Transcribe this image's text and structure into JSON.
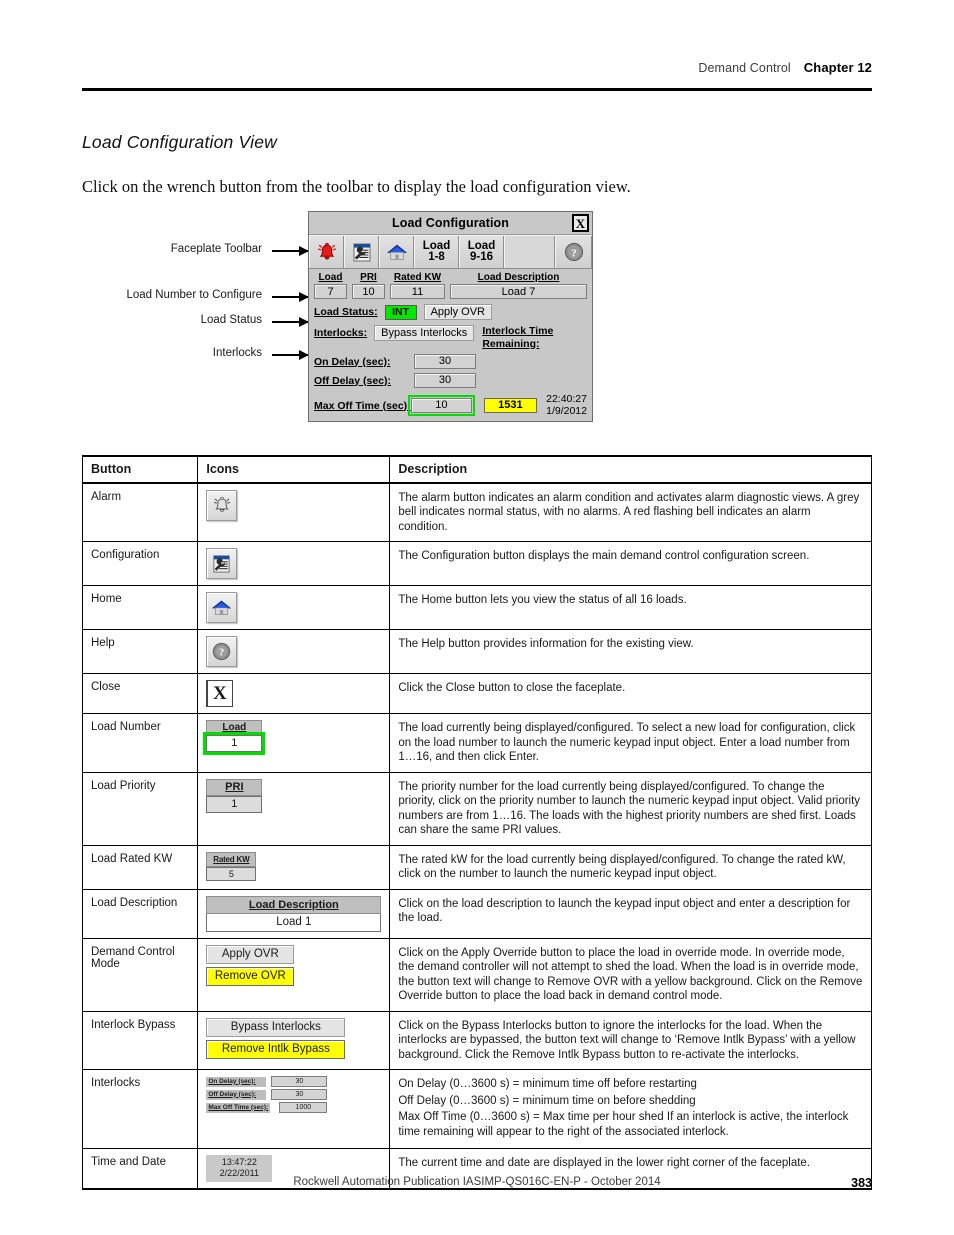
{
  "header": {
    "section": "Demand Control",
    "chapter": "Chapter 12"
  },
  "section_title": "Load Configuration View",
  "intro_text": "Click on the wrench button from the toolbar to display the load configuration view.",
  "callouts": [
    {
      "label": "Faceplate Toolbar"
    },
    {
      "label": "Load Number to Configure"
    },
    {
      "label": "Load Status"
    },
    {
      "label": "Interlocks"
    }
  ],
  "faceplate": {
    "title": "Load Configuration",
    "close_label": "X",
    "toolbar": {
      "alarm_icon": "alarm-bell-icon",
      "configuration_icon": "wrench-config-icon",
      "home_icon": "home-icon",
      "load_1_8": "Load\n1-8",
      "load_1_8_line1": "Load",
      "load_1_8_line2": "1-8",
      "load_9_16_line1": "Load",
      "load_9_16_line2": "9-16",
      "help_icon": "help-question-icon"
    },
    "fields": {
      "load_header": "Load",
      "load_value": "7",
      "pri_header": "PRI",
      "pri_value": "10",
      "rated_kw_header": "Rated KW",
      "rated_kw_value": "11",
      "description_header": "Load Description",
      "description_value": "Load 7"
    },
    "load_status_label": "Load Status:",
    "load_status_value": "INT",
    "apply_ovr_label": "Apply OVR",
    "interlocks_label": "Interlocks:",
    "bypass_interlocks_label": "Bypass Interlocks",
    "interlock_time_remaining_line1": "Interlock Time",
    "interlock_time_remaining_line2": "Remaining:",
    "on_delay_label": "On Delay (sec):",
    "on_delay_value": "30",
    "off_delay_label": "Off Delay (sec):",
    "off_delay_value": "30",
    "max_off_time_label": "Max Off Time (sec):",
    "max_off_time_value": "10",
    "interlock_remaining_value": "1531",
    "clock_time": "22:40:27",
    "clock_date": "1/9/2012",
    "highlight_color": "#00e000",
    "status_color": "#00e800",
    "warn_color": "#ffff00"
  },
  "table": {
    "headers": [
      "Button",
      "Icons",
      "Description"
    ],
    "rows": [
      {
        "button": "Alarm",
        "icon": "alarm-bell-icon",
        "description": "The alarm button indicates an alarm condition and activates alarm diagnostic views. A grey bell indicates normal status, with no alarms. A red flashing bell indicates an alarm condition."
      },
      {
        "button": "Configuration",
        "icon": "wrench-config-icon",
        "description": "The Configuration button displays the main demand control configuration screen."
      },
      {
        "button": "Home",
        "icon": "home-icon",
        "description": "The Home button lets you view the status of all 16 loads."
      },
      {
        "button": "Help",
        "icon": "help-question-icon",
        "description": "The Help button provides information for the existing view."
      },
      {
        "button": "Close",
        "icon": "close-x-icon",
        "icon_label": "X",
        "description": "Click the Close button to close the faceplate."
      },
      {
        "button": "Load Number",
        "icon": "load-number-field",
        "icon_header": "Load",
        "icon_value": "1",
        "description": "The load currently being displayed/configured. To select a new load for configuration, click on the load number to launch the numeric keypad input object. Enter a load number from 1…16, and then click Enter."
      },
      {
        "button": "Load Priority",
        "icon": "load-priority-field",
        "icon_header": "PRI",
        "icon_value": "1",
        "description": "The priority number for the load currently being displayed/configured. To change the priority, click on the priority number to launch the numeric keypad input object. Valid priority numbers are from 1…16. The loads with the highest priority numbers are shed first. Loads can share the same PRI values."
      },
      {
        "button": "Load Rated KW",
        "icon": "rated-kw-field",
        "icon_header": "Rated KW",
        "icon_value": "5",
        "description": "The rated kW for the load currently being displayed/configured. To change the rated kW, click on the number to launch the numeric keypad input object."
      },
      {
        "button": "Load Description",
        "icon": "load-description-field",
        "icon_header": "Load Description",
        "icon_value": "Load 1",
        "description": "Click on the load description to launch the keypad input object and enter a description for the load."
      },
      {
        "button": "Demand Control Mode",
        "icon": "demand-control-mode-buttons",
        "icon_value": "Apply OVR",
        "icon_value_2": "Remove OVR",
        "description": "Click on the Apply Override button to place the load in override mode. In override mode, the demand controller will not attempt to shed the load. When the load is in override mode, the button text will change to Remove OVR with a yellow background. Click on the Remove Override button to place the load back in demand control mode."
      },
      {
        "button": "Interlock Bypass",
        "icon": "interlock-bypass-buttons",
        "icon_value": "Bypass Interlocks",
        "icon_value_2": "Remove Intlk Bypass",
        "description": "Click on the Bypass Interlocks button to ignore the interlocks for the load. When the interlocks are bypassed, the button text will change to ‘Remove Intlk Bypass’ with a yellow background. Click the Remove Intlk Bypass button to re-activate the interlocks."
      },
      {
        "button": "Interlocks",
        "icon": "interlocks-fields",
        "icon_rows": [
          {
            "label": "On Delay (sec):",
            "value": "30"
          },
          {
            "label": "Off Delay (sec):",
            "value": "30"
          },
          {
            "label": "Max Off Time (sec):",
            "value": "1000"
          }
        ],
        "description_lines": [
          "On Delay (0…3600 s) = minimum time off before restarting",
          "Off Delay (0…3600 s) = minimum time on before shedding",
          "Max Off Time (0…3600 s) = Max time per hour shed If an interlock is active, the interlock time remaining will appear to the right of the associated interlock."
        ]
      },
      {
        "button": "Time and Date",
        "icon": "time-date-display",
        "icon_value": "13:47:22",
        "icon_value_2": "2/22/2011",
        "description": "The current time and date are displayed in the lower right corner of the faceplate."
      }
    ]
  },
  "footer": {
    "publication": "Rockwell Automation Publication IASIMP-QS016C-EN-P - October 2014",
    "page_number": "383"
  }
}
